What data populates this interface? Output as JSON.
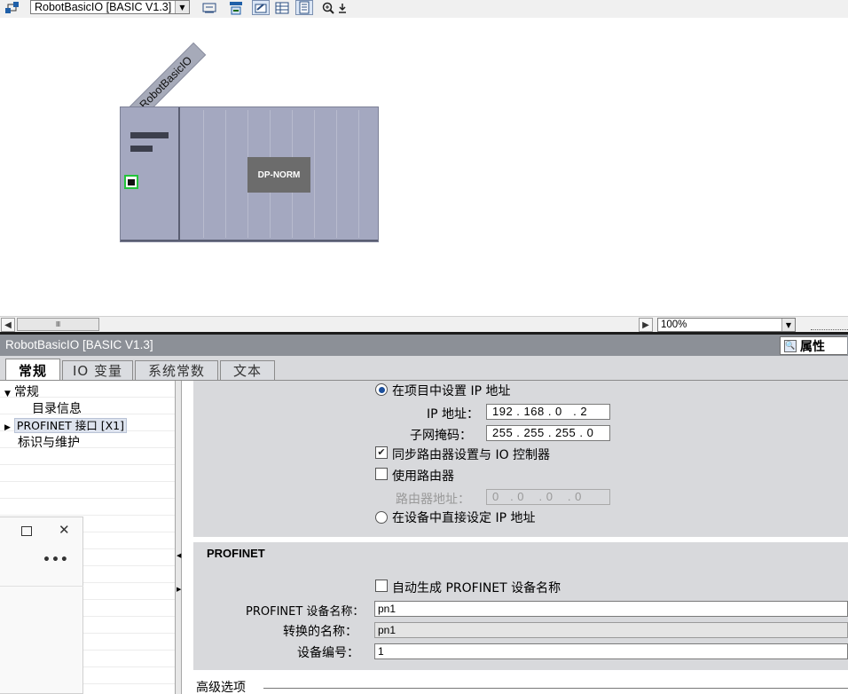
{
  "toolbar": {
    "device_select": "RobotBasicIO [BASIC V1.3]",
    "icons": [
      "network-view-icon",
      "swap-icon",
      "addr-icon",
      "edit-icon",
      "table-icon",
      "page-icon",
      "zoom-in-icon",
      "zoom-down-icon"
    ]
  },
  "canvas": {
    "device_tag": "RobotBasicIO",
    "module_label": "DP-NORM"
  },
  "scroll": {
    "hthumb_grip": "Ⅲ",
    "zoom_value": "100%"
  },
  "inspector": {
    "title": "RobotBasicIO [BASIC V1.3]",
    "properties_label": "属性",
    "tabs": [
      {
        "label": "常规"
      },
      {
        "label": "IO 变量"
      },
      {
        "label": "系统常数"
      },
      {
        "label": "文本"
      }
    ]
  },
  "nav": {
    "items": [
      {
        "label": "常规"
      },
      {
        "label": "目录信息"
      },
      {
        "label": "PROFINET 接口 [X1]"
      },
      {
        "label": "标识与维护"
      }
    ]
  },
  "ip_section": {
    "set_ip_in_project": "在项目中设置 IP 地址",
    "ip_label": "IP 地址：",
    "ip_value": "192 . 168 . 0   . 2",
    "subnet_label": "子网掩码：",
    "subnet_value": "255 . 255 . 255 . 0",
    "sync_router": "同步路由器设置与 IO 控制器",
    "use_router": "使用路由器",
    "router_label": "路由器地址：",
    "router_value": "0   . 0    . 0    . 0",
    "set_ip_on_device": "在设备中直接设定 IP 地址"
  },
  "profinet_section": {
    "title": "PROFINET",
    "auto_name": "自动生成 PROFINET 设备名称",
    "device_name_label": "PROFINET 设备名称：",
    "device_name_value": "pn1",
    "converted_name_label": "转换的名称：",
    "converted_name_value": "pn1",
    "device_number_label": "设备编号：",
    "device_number_value": "1"
  },
  "advanced": {
    "label": "高级选项"
  }
}
